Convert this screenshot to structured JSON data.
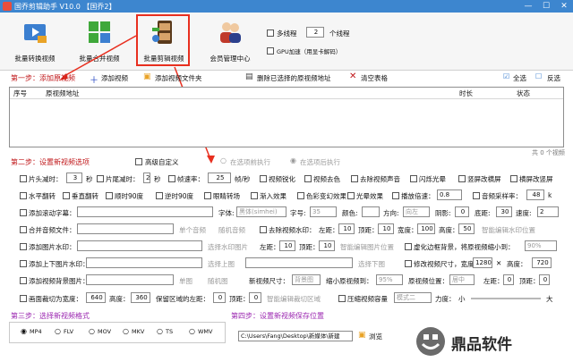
{
  "window": {
    "title": "国乔剪辑助手 V10.0    【国乔2】",
    "min": "—",
    "max": "☐",
    "close": "✕"
  },
  "toolbar": {
    "tools": [
      {
        "label": "批量转换视频",
        "icon": "film-convert-icon"
      },
      {
        "label": "批量合并视频",
        "icon": "grid-merge-icon"
      },
      {
        "label": "批量剪辑视频",
        "icon": "film-edit-icon"
      },
      {
        "label": "会员管理中心",
        "icon": "users-icon"
      }
    ],
    "multithread_label": "多线程",
    "thread_count": "2",
    "thread_unit": "个线程",
    "gpu_label": "GPU加速（用显卡解码）"
  },
  "step1": {
    "label": "第一步：添加原视频",
    "add_video": "添加视频",
    "add_folder": "添加视频文件夹",
    "delete_selected": "删除已选择的原视频地址",
    "clear": "清空表格",
    "select_all": "全选",
    "invert": "反选",
    "columns": {
      "seq": "序号",
      "path": "原视频地址",
      "duration": "时长",
      "status": "状态"
    },
    "count": "共 0 个视频"
  },
  "step2": {
    "label": "第二步：设置新视频选项",
    "advanced": "高级自定义",
    "before": "在选项前执行",
    "after": "在选项后执行",
    "r1": {
      "cut_head": "片头减时：",
      "cut_head_val": "3",
      "sec": "秒",
      "cut_tail": "片尾减时：",
      "cut_tail_val": "2",
      "sec2": "秒",
      "fps": "帧速率：",
      "fps_val": "25",
      "fps_unit": "帧/秒",
      "sharpen": "视频锐化",
      "decolor": "视频去色",
      "remove_audio": "去除视频声音",
      "flash": "闪烁光晕",
      "landscape": "竖屏改横屏",
      "crop": "横屏改竖屏"
    },
    "r2": {
      "hflip": "水平翻转",
      "vflip": "垂直翻转",
      "cw90": "顺时90度",
      "ccw90": "逆时90度",
      "mirror": "眼睛转场",
      "fadein": "渐入效果",
      "color_shift": "色彩变幻效果",
      "light": "光晕效果",
      "speed": "播放倍速：",
      "speed_val": "0.8",
      "sample": "音频采样率：",
      "sample_val": "48",
      "k": "k"
    },
    "r3": {
      "scroll": "添加滚动字幕：",
      "font": "字体:",
      "font_val": "黑体(simhei)",
      "size": "字号:",
      "size_val": "35",
      "color": "颜色:",
      "dir": "方向:",
      "dir_val": "向左",
      "shadow": "阴影:",
      "shadow_val": "0",
      "bottom": "底距:",
      "bottom_val": "30",
      "speed": "速度:",
      "speed_val": "2"
    },
    "r4": {
      "merge_audio": "合并音频文件：",
      "single": "单个音频",
      "random": "随机音频",
      "remove_wm": "去除视频水印：",
      "left": "左距：",
      "left_val": "10",
      "top": "顶距：",
      "top_val": "10",
      "width": "宽度：",
      "width_val": "100",
      "height": "高度：",
      "height_val": "50",
      "smart": "智能编辑水印位置"
    },
    "r5": {
      "add_img_wm": "添加图片水印：",
      "choose": "选择水印图片",
      "left": "左距：",
      "left_val": "10",
      "top": "顶距：",
      "top_val": "10",
      "smart": "智能编辑图片位置",
      "blur": "虚化边框背景，将原视频缩小到：",
      "blur_val": "90%"
    },
    "r6": {
      "add_topbottom": "添加上下图片水印：",
      "choose_top": "选择上图",
      "choose_bottom": "选择下图",
      "resize": "修改视频尺寸，宽度：",
      "width_val": "1280",
      "x": "✕",
      "height": "高度：",
      "height_val": "720"
    },
    "r7": {
      "bg": "添加视频背景图片：",
      "single": "单图",
      "random": "随机图",
      "size": "新视频尺寸：",
      "size_val": "背景图",
      "shrink": "缩小原视频到：",
      "shrink_val": "95%",
      "pos": "原视频位置：",
      "pos_val": "居中",
      "left": "左距：",
      "left_val": "0",
      "top": "顶距：",
      "top_val": "0"
    },
    "r8": {
      "crop": "画面裁切为宽度：",
      "width_val": "640",
      "height": "高度：",
      "height_val": "360",
      "keep": "保留区域的左距：",
      "left_val": "0",
      "top": "顶距：",
      "top_val": "0",
      "smart": "智能编辑裁切区域",
      "compress": "压缩视频容量",
      "mode_val": "模式二",
      "strength": "力度：",
      "small": "小",
      "big": "大"
    }
  },
  "step3": {
    "label": "第三步：选择新视频格式",
    "formats": [
      "MP4",
      "FLV",
      "MOV",
      "MKV",
      "TS",
      "WMV"
    ],
    "selected": "MP4"
  },
  "step4": {
    "label": "第四步：设置新视频保存位置",
    "path": "C:\\Users\\Fang\\Desktop\\新媒体\\新建",
    "browse": "浏览"
  },
  "watermark": {
    "text": "鼎品软件"
  },
  "colors": {
    "titlebar": "#3d86cf",
    "highlight": "#e82f1f",
    "section": "#c0171a",
    "step34": "#9b27b0"
  }
}
